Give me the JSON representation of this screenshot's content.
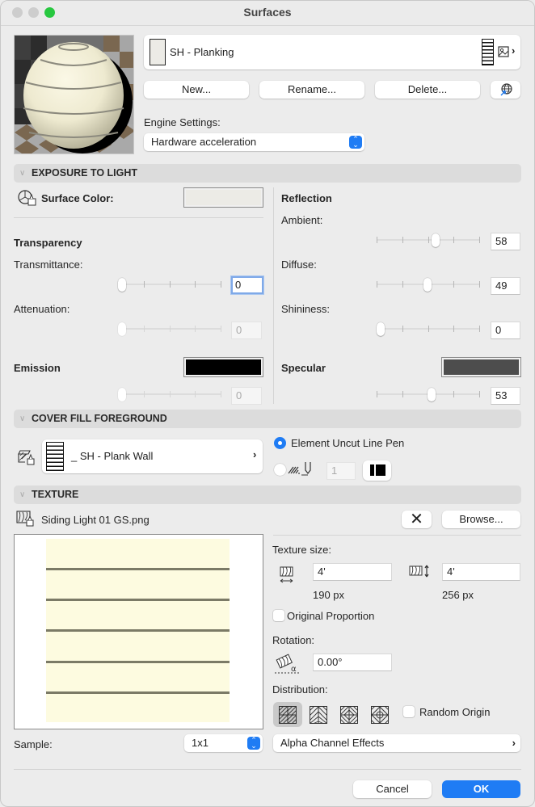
{
  "window": {
    "title": "Surfaces",
    "traffic_lights": {
      "close": "#c9c9c9",
      "minimize": "#c9c9c9",
      "zoom": "#28c840"
    }
  },
  "header": {
    "surface_name": "SH - Planking",
    "new_label": "New...",
    "rename_label": "Rename...",
    "delete_label": "Delete...",
    "engine_settings_label": "Engine Settings:",
    "engine_settings_value": "Hardware acceleration"
  },
  "exposure": {
    "section_title": "EXPOSURE TO LIGHT",
    "surface_color_label": "Surface Color:",
    "surface_color": "#ecebe6",
    "transparency_title": "Transparency",
    "transmittance_label": "Transmittance:",
    "transmittance_value": "0",
    "transmittance_fraction": 0,
    "attenuation_label": "Attenuation:",
    "attenuation_value": "0",
    "attenuation_fraction": 0,
    "emission_label": "Emission",
    "emission_color": "#000000",
    "emission_value": "0",
    "emission_fraction": 0,
    "reflection_title": "Reflection",
    "ambient_label": "Ambient:",
    "ambient_value": "58",
    "ambient_fraction": 0.58,
    "diffuse_label": "Diffuse:",
    "diffuse_value": "49",
    "diffuse_fraction": 0.49,
    "shininess_label": "Shininess:",
    "shininess_value": "0",
    "shininess_fraction": 0,
    "specular_label": "Specular",
    "specular_color": "#4d4d4d",
    "specular_value": "53",
    "specular_fraction": 0.53
  },
  "cover_fill": {
    "section_title": "COVER FILL FOREGROUND",
    "fill_name": "_ SH - Plank Wall",
    "pen_option_label": "Element Uncut Line Pen",
    "pen_option_selected": true,
    "pen_number": "1"
  },
  "texture": {
    "section_title": "TEXTURE",
    "file_name": "Siding Light 01 GS.png",
    "browse_label": "Browse...",
    "texture_size_label": "Texture size:",
    "width_value": "4'",
    "height_value": "4'",
    "width_px": "190 px",
    "height_px": "256 px",
    "original_proportion_label": "Original Proportion",
    "original_proportion_checked": false,
    "rotation_label": "Rotation:",
    "rotation_value": "0.00°",
    "distribution_label": "Distribution:",
    "distribution_selected": 0,
    "random_origin_label": "Random Origin",
    "random_origin_checked": false,
    "sample_label": "Sample:",
    "sample_value": "1x1",
    "alpha_channel_label": "Alpha Channel Effects"
  },
  "footer": {
    "cancel_label": "Cancel",
    "ok_label": "OK",
    "accent": "#1f7cf4"
  }
}
